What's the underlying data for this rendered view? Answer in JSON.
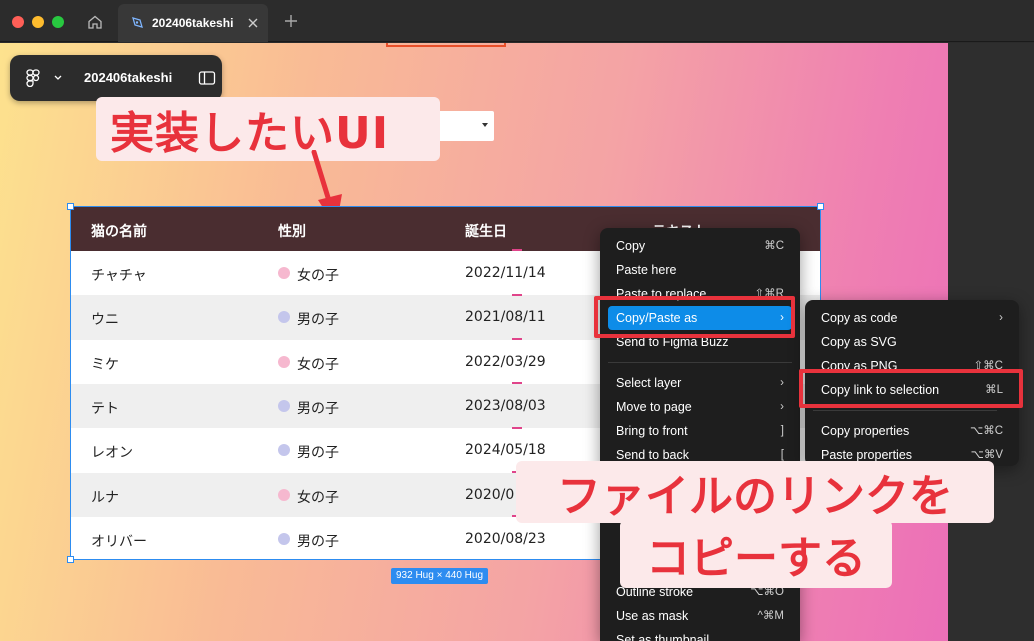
{
  "window": {
    "tab_title": "202406takeshi"
  },
  "toolbar": {
    "file_name": "202406takeshi"
  },
  "callouts": {
    "implement_ui": "実装したいUI",
    "copy_link_line1": "ファイルのリンクを",
    "copy_link_line2": "コピーする"
  },
  "table": {
    "headers": [
      "猫の名前",
      "性別",
      "誕生日",
      "テキスト"
    ],
    "rows": [
      {
        "name": "チャチャ",
        "gender": "女の子",
        "gender_color": "#f6b8cf",
        "birthday": "2022/11/14"
      },
      {
        "name": "ウニ",
        "gender": "男の子",
        "gender_color": "#c4c6ec",
        "birthday": "2021/08/11"
      },
      {
        "name": "ミケ",
        "gender": "女の子",
        "gender_color": "#f6b8cf",
        "birthday": "2022/03/29"
      },
      {
        "name": "テト",
        "gender": "男の子",
        "gender_color": "#c4c6ec",
        "birthday": "2023/08/03"
      },
      {
        "name": "レオン",
        "gender": "男の子",
        "gender_color": "#c4c6ec",
        "birthday": "2024/05/18"
      },
      {
        "name": "ルナ",
        "gender": "女の子",
        "gender_color": "#f6b8cf",
        "birthday": "2020/0"
      },
      {
        "name": "オリバー",
        "gender": "男の子",
        "gender_color": "#c4c6ec",
        "birthday": "2020/08/23"
      }
    ],
    "size_badge": "932 Hug × 440 Hug"
  },
  "context_menu": {
    "items": [
      {
        "label": "Copy",
        "shortcut": "⌘C"
      },
      {
        "label": "Paste here",
        "shortcut": ""
      },
      {
        "label": "Paste to replace",
        "shortcut": "⇧⌘R"
      },
      {
        "label": "Copy/Paste as",
        "shortcut": "›"
      },
      {
        "label": "Send to Figma Buzz",
        "shortcut": ""
      },
      {
        "label": "Select layer",
        "shortcut": "›"
      },
      {
        "label": "Move to page",
        "shortcut": "›"
      },
      {
        "label": "Bring to front",
        "shortcut": "]"
      },
      {
        "label": "Send to back",
        "shortcut": "["
      },
      {
        "label": "Outline stroke",
        "shortcut": "⌥⌘O"
      },
      {
        "label": "Use as mask",
        "shortcut": "^⌘M"
      },
      {
        "label": "Set as thumbnail",
        "shortcut": ""
      }
    ]
  },
  "submenu": {
    "items": [
      {
        "label": "Copy as code",
        "shortcut": "›"
      },
      {
        "label": "Copy as SVG",
        "shortcut": ""
      },
      {
        "label": "Copy as PNG",
        "shortcut": "⇧⌘C"
      },
      {
        "label": "Copy link to selection",
        "shortcut": "⌘L"
      },
      {
        "label": "Copy properties",
        "shortcut": "⌥⌘C"
      },
      {
        "label": "Paste properties",
        "shortcut": "⌥⌘V"
      }
    ]
  },
  "colors": {
    "accent_blue": "#0d8ce8",
    "annotation_red": "#e8323c",
    "table_header": "#4a2d30"
  }
}
